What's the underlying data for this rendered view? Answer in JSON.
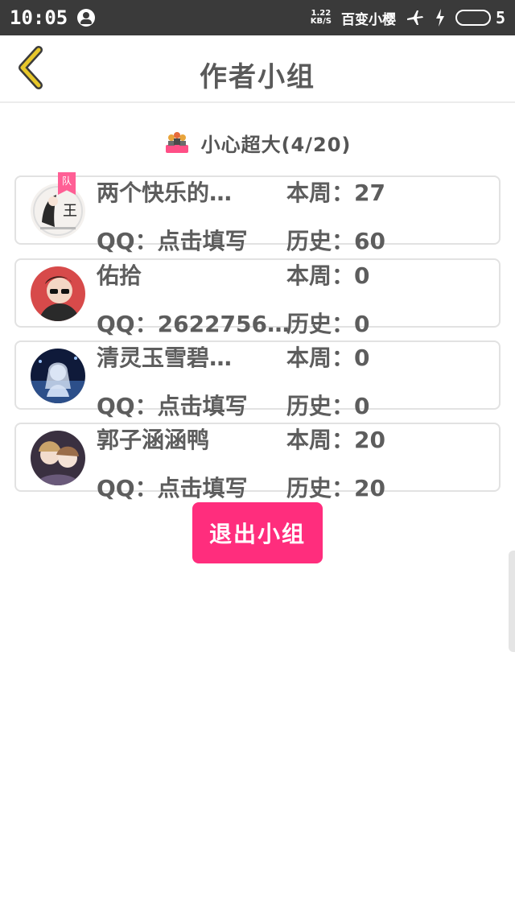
{
  "status_bar": {
    "time": "10:05",
    "speed_value": "1.22",
    "speed_unit": "KB/S",
    "carrier": "百变小樱",
    "battery_level": "5"
  },
  "header": {
    "title": "作者小组",
    "back_icon": "chevron-left-icon"
  },
  "team": {
    "icon": "team-icon",
    "name": "小心超大(4/20)"
  },
  "members": [
    {
      "name": "两个快乐的…",
      "qq": "QQ：点击填写",
      "week": "本周：27",
      "total": "历史：60",
      "badge": "队"
    },
    {
      "name": "佑拾",
      "qq": "QQ：2622756…",
      "week": "本周：0",
      "total": "历史：0"
    },
    {
      "name": "清灵玉雪碧…",
      "qq": "QQ：点击填写",
      "week": "本周：0",
      "total": "历史：0"
    },
    {
      "name": "郭子涵涵鸭",
      "qq": "QQ：点击填写",
      "week": "本周：20",
      "total": "历史：20"
    }
  ],
  "actions": {
    "quit_label": "退出小组"
  },
  "colors": {
    "accent": "#ff2d7d",
    "back_icon": "#e7c72a",
    "status_bg": "#3a3a3a"
  }
}
